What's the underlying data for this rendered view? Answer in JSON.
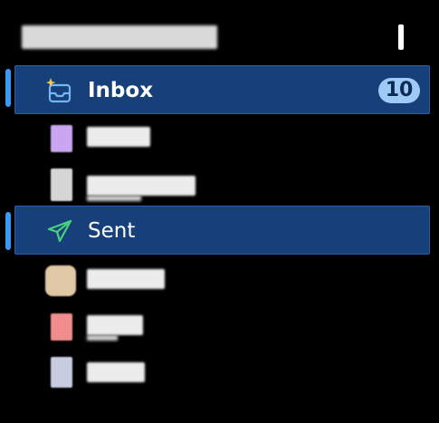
{
  "header": {
    "title": "",
    "handle": ""
  },
  "folders": [
    {
      "id": "inbox",
      "label": "Inbox",
      "icon": "inbox-tray-icon",
      "badge": "10",
      "selected": true
    },
    {
      "id": "drafts",
      "label": "",
      "icon": "drafts-icon",
      "selected": false,
      "obscured": true
    },
    {
      "id": "outbox",
      "label": "",
      "icon": "outbox-icon",
      "selected": false,
      "obscured": true
    },
    {
      "id": "sent",
      "label": "Sent",
      "icon": "paper-plane-icon",
      "selected": true
    },
    {
      "id": "archive",
      "label": "",
      "icon": "archive-icon",
      "selected": false,
      "obscured": true
    },
    {
      "id": "spam",
      "label": "",
      "icon": "spam-icon",
      "selected": false,
      "obscured": true
    },
    {
      "id": "trash",
      "label": "",
      "icon": "trash-icon",
      "selected": false,
      "obscured": true
    }
  ],
  "colors": {
    "selected_bg": "#173f7a",
    "selected_border": "#2a5ea8",
    "accent_bar": "#3c9af2",
    "badge_bg": "#9ecaf7",
    "badge_text": "#0c2a52",
    "inbox_icon": "#73b6f5",
    "sparkle": "#f2c94c",
    "sent_icon": "#48d17c",
    "drafts_icon": "#caa6f2",
    "outbox_icon": "#d6d6d6",
    "archive_icon": "#e0c8a6",
    "spam_icon": "#f28d8d",
    "trash_icon": "#c8cce0"
  }
}
